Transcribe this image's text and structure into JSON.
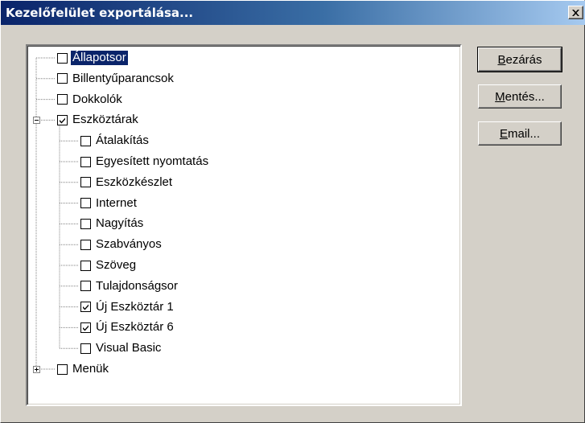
{
  "window": {
    "title": "Kezelőfelület exportálása...",
    "close_glyph": "✕"
  },
  "tree": {
    "nodes": [
      {
        "label": "Állapotsor",
        "checked": false,
        "level": 0,
        "selected": true
      },
      {
        "label": "Billentyűparancsok",
        "checked": false,
        "level": 0
      },
      {
        "label": "Dokkolók",
        "checked": false,
        "level": 0
      },
      {
        "label": "Eszköztárak",
        "checked": true,
        "level": 0,
        "expander": "minus"
      },
      {
        "label": "Átalakítás",
        "checked": false,
        "level": 1
      },
      {
        "label": "Egyesített nyomtatás",
        "checked": false,
        "level": 1
      },
      {
        "label": "Eszközkészlet",
        "checked": false,
        "level": 1
      },
      {
        "label": "Internet",
        "checked": false,
        "level": 1
      },
      {
        "label": "Nagyítás",
        "checked": false,
        "level": 1
      },
      {
        "label": "Szabványos",
        "checked": false,
        "level": 1
      },
      {
        "label": "Szöveg",
        "checked": false,
        "level": 1
      },
      {
        "label": "Tulajdonságsor",
        "checked": false,
        "level": 1
      },
      {
        "label": "Új Eszköztár 1",
        "checked": true,
        "level": 1
      },
      {
        "label": "Új Eszköztár 6",
        "checked": true,
        "level": 1
      },
      {
        "label": "Visual Basic",
        "checked": false,
        "level": 1
      },
      {
        "label": "Menük",
        "checked": false,
        "level": 0,
        "expander": "plus"
      }
    ]
  },
  "buttons": {
    "close": {
      "mnemonic": "B",
      "rest": "ezárás"
    },
    "save": {
      "mnemonic": "M",
      "rest": "entés..."
    },
    "email": {
      "mnemonic": "E",
      "rest": "mail..."
    }
  },
  "icons": {
    "checkmark": "checkmark-icon",
    "close": "close-icon",
    "expand": "plus-icon",
    "collapse": "minus-icon"
  }
}
